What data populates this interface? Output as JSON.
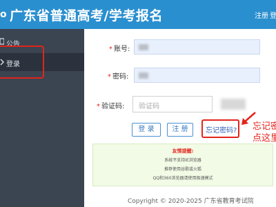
{
  "header": {
    "logo_glyph": "o",
    "title": "广东省普通高考/学考报名",
    "register_link": "注册",
    "login_link": "登"
  },
  "sidebar": {
    "items": [
      {
        "label": "公告",
        "icon": "announcement-icon"
      },
      {
        "label": "登录",
        "icon": "login-icon",
        "active": true
      }
    ]
  },
  "form": {
    "account_label": "账号:",
    "password_label": "密码:",
    "captcha_label": "验证码:",
    "captcha_placeholder": "验证码",
    "required_mark": "*",
    "login_button": "登 录",
    "register_button": "注 册",
    "forgot_password": "忘记密码?"
  },
  "annotation": {
    "line1": "忘记密",
    "line2": "点这里"
  },
  "notice": {
    "title": "友情提醒:",
    "lines": [
      "系统不支持IE浏览器",
      "推荐使用谷歌或火狐",
      "QQ和360浏览器请使用极速模式"
    ]
  },
  "footer": {
    "copyright": "Copyright © 2020-2025 广东省教育考试院"
  },
  "colors": {
    "header_bg": "#2a8fcf",
    "sidebar_bg": "#3b4451",
    "highlight_red": "#e3241b",
    "notice_bg": "#f2fbe6"
  }
}
